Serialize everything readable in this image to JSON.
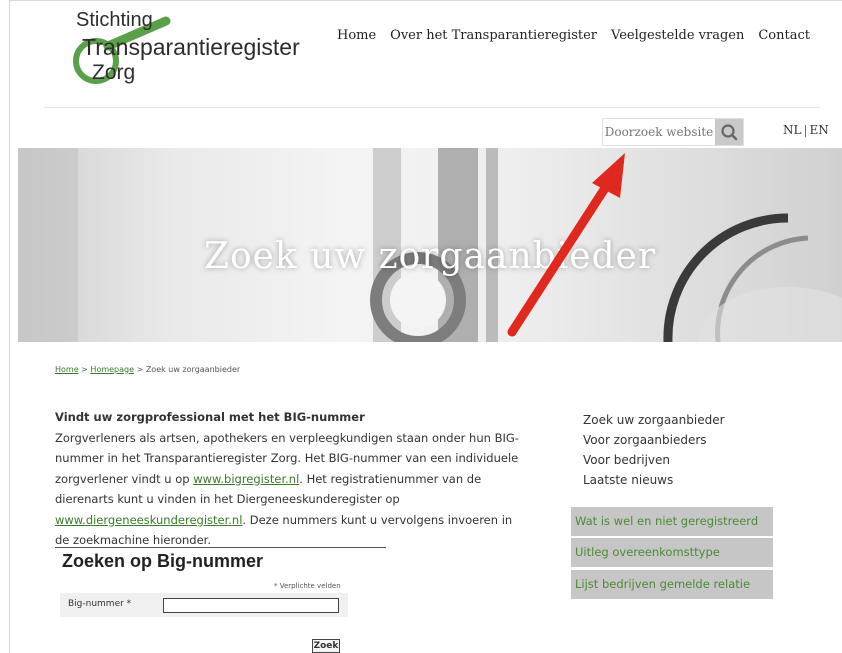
{
  "logo": {
    "line1": "Stichting",
    "line2": "Transparantieregister",
    "line3": "Zorg",
    "color_green": "#5aa04a"
  },
  "nav": {
    "items": [
      "Home",
      "Over het Transparantieregister",
      "Veelgestelde vragen",
      "Contact"
    ]
  },
  "search": {
    "placeholder": "Doorzoek website",
    "icon": "search-icon"
  },
  "lang": {
    "nl": "NL",
    "en": "EN"
  },
  "hero": {
    "title": "Zoek uw zorgaanbieder"
  },
  "breadcrumb": {
    "home": "Home",
    "sep1": " > ",
    "homepage": "Homepage",
    "sep2": " > ",
    "current": "Zoek uw zorgaanbieder"
  },
  "content": {
    "heading": "Vindt uw zorgprofessional met het BIG-nummer",
    "p1": "Zorgverleners als artsen, apothekers en verpleegkundigen staan onder hun BIG-nummer in het Transparantieregister Zorg. Het BIG-nummer van een individuele zorgverlener vindt u op ",
    "link1": "www.bigregister.nl",
    "p2": ". Het registratienummer van de dierenarts kunt u vinden in het Diergeneeskunderegister op ",
    "link2": "www.diergeneeskunderegister.nl",
    "p3": ". Deze nummers kunt u vervolgens invoeren in de zoekmachine hieronder."
  },
  "sidebar": {
    "links": [
      "Zoek uw zorgaanbieder",
      "Voor zorgaanbieders",
      "Voor bedrijven",
      "Laatste nieuws"
    ],
    "buttons": [
      "Wat is wel en niet geregistreerd",
      "Uitleg overeenkomsttype",
      "Lijst bedrijven gemelde relatie"
    ]
  },
  "big_search": {
    "title": "Zoeken op Big-nummer",
    "required_note": "* Verplichte velden",
    "label": "Big-nummer *",
    "value": "",
    "button": "Zoek"
  },
  "colors": {
    "accent_green": "#4a8a35",
    "arrow_red": "#e0291e"
  }
}
